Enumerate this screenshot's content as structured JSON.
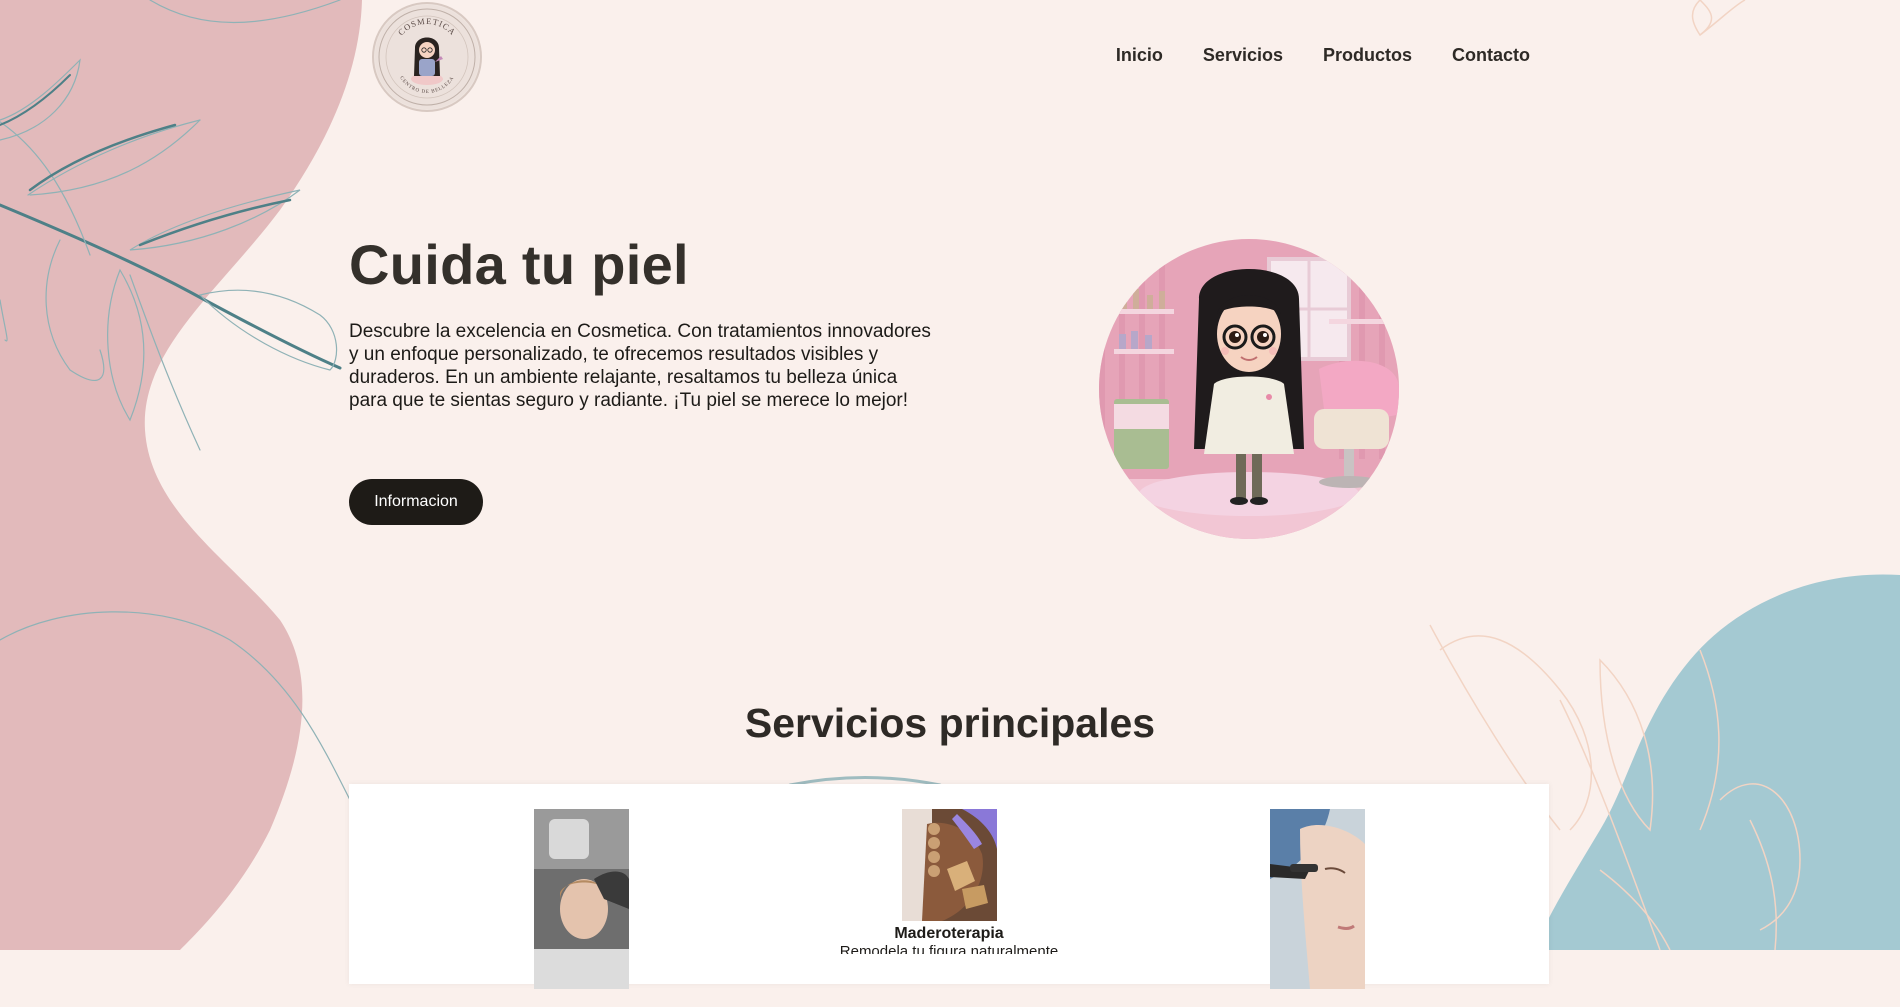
{
  "colors": {
    "background": "#faf0ec",
    "pink_blob": "#e2babb",
    "blue_blob": "#a4c9d2",
    "leaf_teal": "#4e8087",
    "button": "#1e1b17"
  },
  "logo": {
    "top_text": "COSMETICA",
    "bottom_text": "CENTRO DE BELLEZA"
  },
  "nav": {
    "items": [
      "Inicio",
      "Servicios",
      "Productos",
      "Contacto"
    ]
  },
  "hero": {
    "title": "Cuida tu piel",
    "description": "Descubre la excelencia en Cosmetica. Con tratamientos innovadores y un enfoque personalizado, te ofrecemos resultados visibles y duraderos. En un ambiente relajante, resaltamos tu belleza única para que te sientas seguro y radiante. ¡Tu piel se merece lo mejor!",
    "button_label": "Informacion"
  },
  "services": {
    "title": "Servicios principales",
    "items": [
      {
        "name": "",
        "description": "",
        "icon": "facial-treatment-photo"
      },
      {
        "name": "Maderoterapia",
        "description": "Remodela tu figura naturalmente",
        "icon": "wood-therapy-photo"
      },
      {
        "name": "",
        "description": "",
        "icon": "injection-treatment-photo"
      }
    ]
  }
}
